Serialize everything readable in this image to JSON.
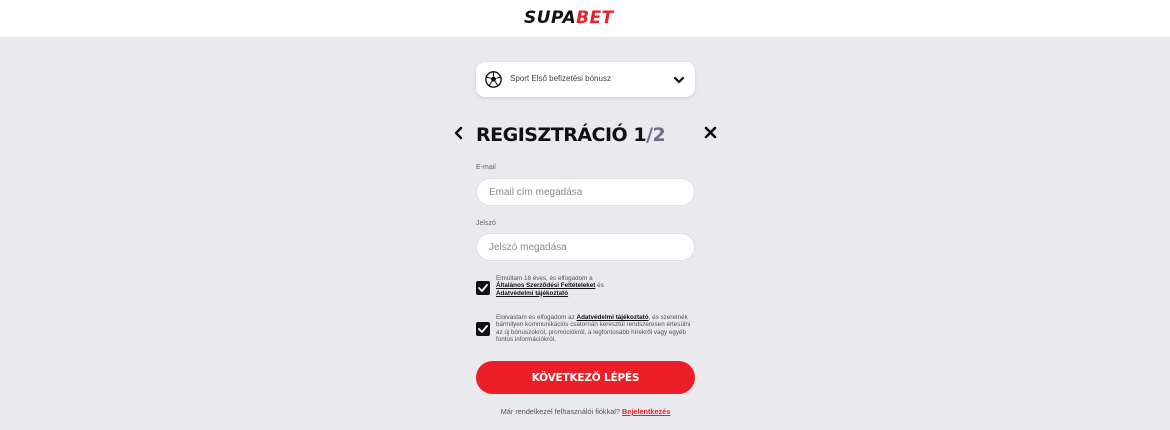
{
  "header": {
    "logo_main": "SUPA",
    "logo_accent": "BET"
  },
  "bonus_select": {
    "label": "Sport Első befizetési bónusz",
    "icon": "soccer-ball-icon"
  },
  "registration": {
    "title": "REGISZTRÁCIÓ",
    "step_current": "1",
    "step_total": "/2"
  },
  "email": {
    "label": "E-mail",
    "placeholder": "Email cím megadása",
    "value": ""
  },
  "password": {
    "label": "Jelszó",
    "placeholder": "Jelszó megadása",
    "value": ""
  },
  "consent_terms": {
    "checked": true,
    "text_before": "Elmúltam 18 éves, és elfogadom a",
    "terms_link": "Általános Szerződési Feltételeket",
    "text_middle": "és",
    "privacy_link": "Adatvédelmi tájékoztató"
  },
  "consent_marketing": {
    "checked": true,
    "text_before": "Elolvastam és elfogadom az",
    "privacy_link": "Adatvédelmi tájékoztató",
    "text_after": ", és szeretnék bármilyen kommunikációs csatornán keresztül rendszeresen értesülni az új bónuszokról, promóciókról, a legfontosabb hírekről vagy egyéb fontos információkról."
  },
  "next_button": "KÖVETKEZŐ LÉPÉS",
  "login_prompt": {
    "text": "Már rendelkezel felhasználói fiókkal?",
    "link": "Bejelentkezés"
  },
  "colors": {
    "brand_red": "#ea1f27",
    "background": "#e9e9ee",
    "text_dark": "#111111"
  }
}
